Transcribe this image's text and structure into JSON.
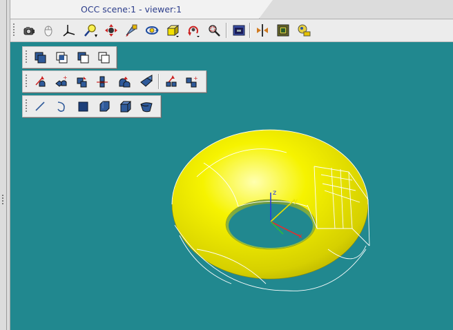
{
  "viewer": {
    "tab_title": "OCC scene:1 - viewer:1",
    "background_color": "#21888f",
    "shape_color": "#f2f200",
    "shape": "torus",
    "axes": {
      "x_label": "x",
      "y_label": "y",
      "z_label": "z"
    }
  },
  "main_toolbar": {
    "buttons": [
      "camera-icon",
      "mouse-icon",
      "trihedron-icon",
      "zoom-icon",
      "pan-icon",
      "global-pan-icon",
      "rotate-icon",
      "fit-all-icon",
      "reset-view-icon",
      "fit-area-icon",
      "clone-view-icon",
      "clipping-plane-icon",
      "shading-icon",
      "material-icon"
    ]
  },
  "boolean_toolbar": {
    "buttons": [
      "fuse-icon",
      "common-icon",
      "cut-icon",
      "section-icon"
    ]
  },
  "transform_toolbar": {
    "buttons": [
      "translate-icon",
      "rotate-shape-icon",
      "mirror-icon",
      "scale-icon",
      "offset-icon",
      "extrude-icon",
      "multi-translate-icon",
      "multi-rotate-icon"
    ]
  },
  "primitive_toolbar": {
    "buttons": [
      "line-icon",
      "arc-icon",
      "box-icon",
      "cylinder-icon",
      "sphere-icon",
      "cone-icon"
    ]
  }
}
